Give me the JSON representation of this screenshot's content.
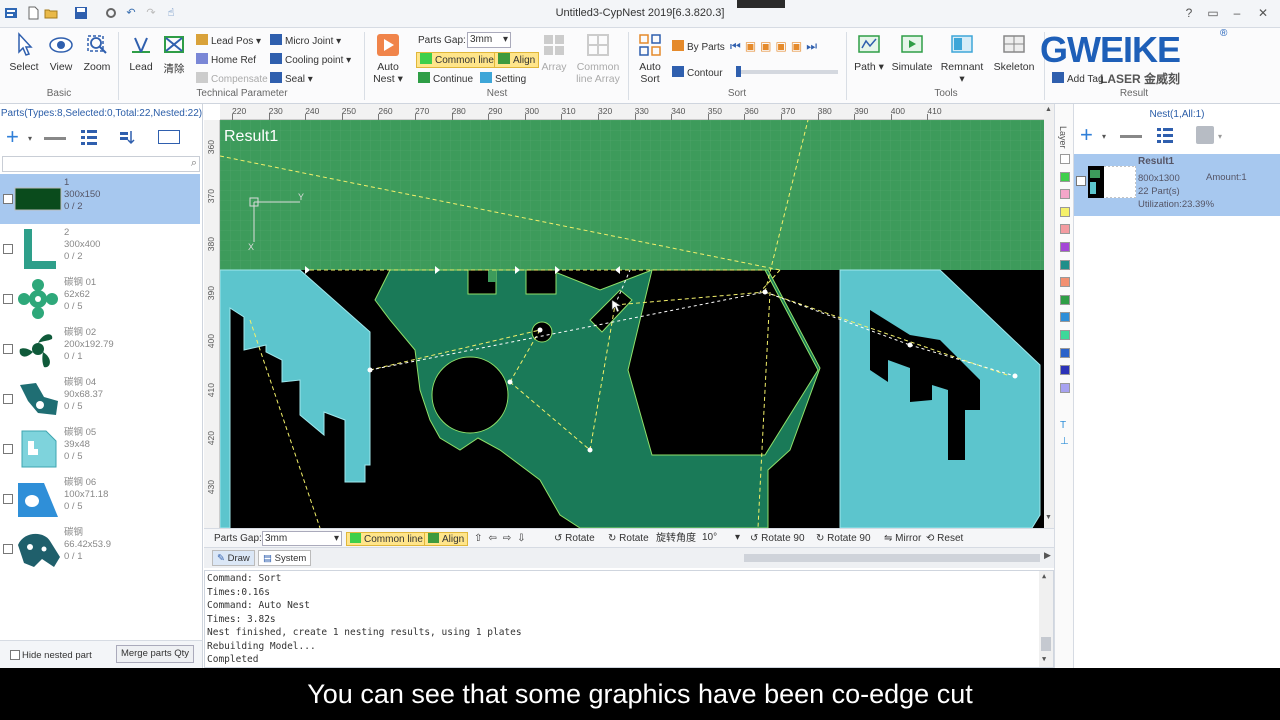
{
  "window": {
    "title": "Untitled3-CypNest 2019[6.3.820.3]"
  },
  "ribbon": {
    "basic": {
      "label": "Basic",
      "select": "Select",
      "view": "View",
      "zoom": "Zoom"
    },
    "technical": {
      "label": "Technical Parameter",
      "lead": "Lead",
      "clear": "清除",
      "lead_pos": "Lead Pos",
      "micro_joint": "Micro Joint",
      "home_ref": "Home Ref",
      "cooling_point": "Cooling point",
      "compensate": "Compensate",
      "seal": "Seal"
    },
    "nest": {
      "label": "Nest",
      "auto_nest_line1": "Auto",
      "auto_nest_line2": "Nest",
      "parts_gap_label": "Parts Gap:",
      "parts_gap_value": "3mm",
      "common_line": "Common line",
      "align": "Align",
      "continue": "Continue",
      "setting": "Setting",
      "array": "Array",
      "common_line_array_1": "Common",
      "common_line_array_2": "line Array"
    },
    "sort": {
      "label": "Sort",
      "auto_sort_1": "Auto",
      "auto_sort_2": "Sort",
      "by_parts": "By Parts",
      "contour": "Contour"
    },
    "tools": {
      "label": "Tools",
      "path": "Path",
      "simulate": "Simulate",
      "remnant": "Remnant",
      "skeleton": "Skeleton"
    },
    "result": {
      "label": "Result",
      "add_tag": "Add Tag",
      "logo_text": "GWEIKE",
      "logo_sub": "LASER 金威刻",
      "registered": "®"
    }
  },
  "parts_panel": {
    "header": "Parts(Types:8,Selected:0,Total:22,Nested:22)",
    "search_placeholder": "",
    "items": [
      {
        "name": "1",
        "size": "300x150",
        "count": "0 / 2"
      },
      {
        "name": "2",
        "size": "300x400",
        "count": "0 / 2"
      },
      {
        "name": "碳钢 01",
        "size": "62x62",
        "count": "0 / 5"
      },
      {
        "name": "碳钢 02",
        "size": "200x192.79",
        "count": "0 / 1"
      },
      {
        "name": "碳钢 04",
        "size": "90x68.37",
        "count": "0 / 5"
      },
      {
        "name": "碳钢 05",
        "size": "39x48",
        "count": "0 / 5"
      },
      {
        "name": "碳钢 06",
        "size": "100x71.18",
        "count": "0 / 5"
      },
      {
        "name": "碳钢",
        "size": "66.42x53.9",
        "count": "0 / 1"
      }
    ],
    "hide_nested": "Hide nested part",
    "merge_qty": "Merge parts Qty"
  },
  "canvas": {
    "result_label": "Result1",
    "h_ticks": [
      "220",
      "230",
      "240",
      "250",
      "260",
      "270",
      "280",
      "290",
      "300",
      "310",
      "320",
      "330",
      "340",
      "350",
      "360",
      "370",
      "380",
      "390",
      "400",
      "410"
    ],
    "v_ticks": [
      "360",
      "370",
      "380",
      "390",
      "400",
      "410",
      "420",
      "430"
    ],
    "axis_y": "Y",
    "axis_x": "X"
  },
  "canvas_toolbar": {
    "parts_gap_label": "Parts Gap:",
    "parts_gap_value": "3mm",
    "common_line": "Common line",
    "align": "Align",
    "rotate": "Rotate",
    "rotate2": "Rotate",
    "angle_label": "旋转角度",
    "angle_value": "10°",
    "rotate90a": "Rotate 90",
    "rotate90b": "Rotate 90",
    "mirror": "Mirror",
    "reset": "Reset"
  },
  "tabs": {
    "draw": "Draw",
    "system": "System"
  },
  "command_log": [
    "Command: Sort",
    "Times:0.16s",
    "Command: Auto Nest",
    "Times: 3.82s",
    "Nest finished, create 1 nesting results, using 1 plates",
    "Rebuilding Model...",
    "Completed"
  ],
  "layer_panel": {
    "label": "Layer",
    "colors": [
      "#ffffff",
      "#3ecf4b",
      "#f4a6c9",
      "#f5f06a",
      "#f39ba0",
      "#a447d6",
      "#1f8f8a",
      "#f29070",
      "#2f9e46",
      "#2f8fd8",
      "#3ed89a",
      "#2b62c9",
      "#2c33b8",
      "#a7a2f0"
    ]
  },
  "nest_panel": {
    "header": "Nest(1,All:1)",
    "result": {
      "name": "Result1",
      "size": "800x1300",
      "parts": "22 Part(s)",
      "utilization": "Utilization:23.39%",
      "amount": "Amount:1"
    }
  },
  "subtitle": "You can see that some graphics have been co-edge cut"
}
